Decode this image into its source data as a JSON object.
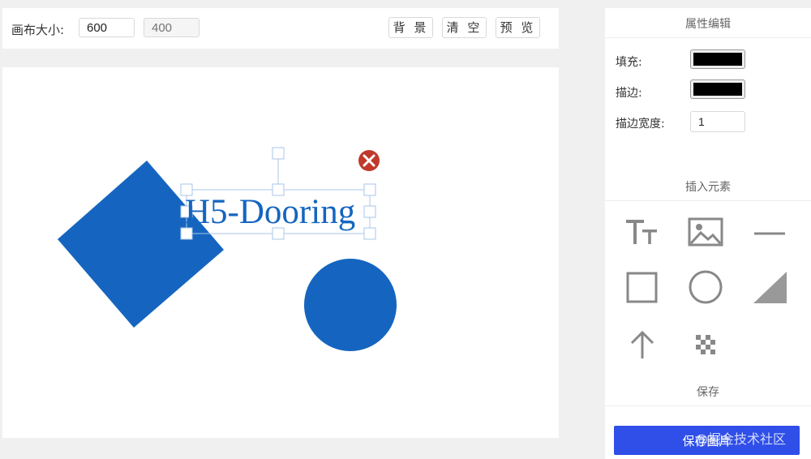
{
  "toolbar": {
    "canvas_size_label": "画布大小:",
    "width_value": "600",
    "height_placeholder": "400",
    "background_button": "背 景",
    "clear_button": "清 空",
    "preview_button": "预 览"
  },
  "canvas": {
    "text_element": "H5-Dooring",
    "shape_color": "#1565c0"
  },
  "panel": {
    "properties_title": "属性编辑",
    "fill_label": "填充:",
    "stroke_label": "描边:",
    "stroke_width_label": "描边宽度:",
    "stroke_width_value": "1",
    "fill_color": "#000000",
    "stroke_color": "#000000",
    "insert_title": "插入元素",
    "elements": [
      "text-icon",
      "image-icon",
      "line-icon",
      "rectangle-icon",
      "circle-icon",
      "triangle-icon",
      "arrow-icon",
      "mosaic-icon"
    ],
    "save_title": "保存",
    "save_image_button": "保存图片"
  },
  "watermark": "@掘金技术社区"
}
